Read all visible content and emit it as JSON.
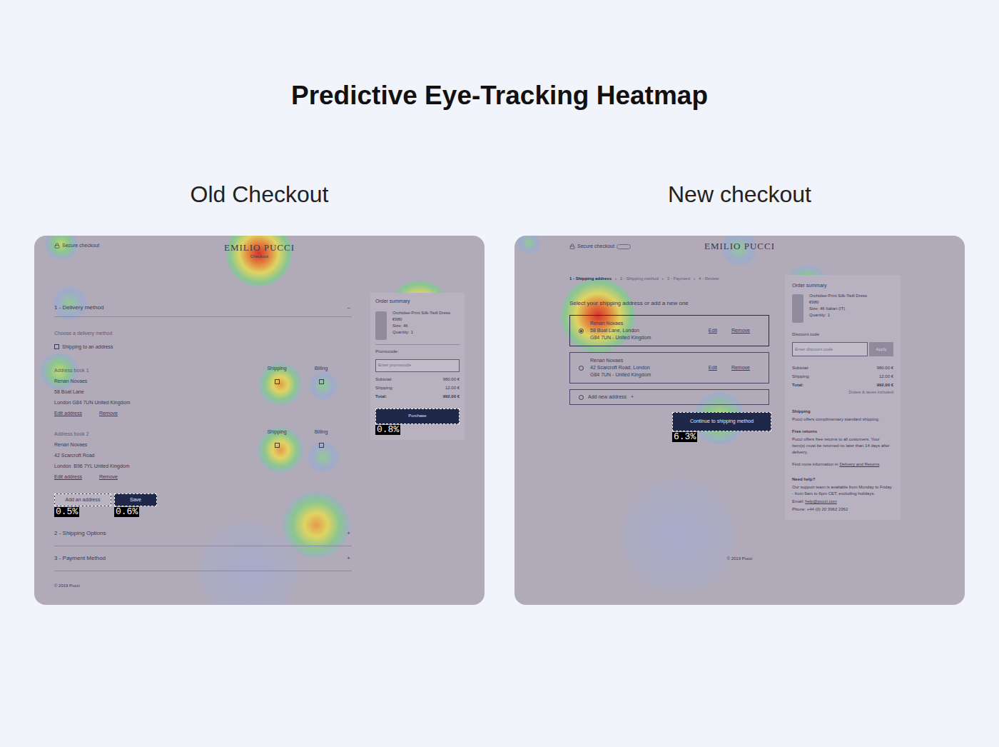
{
  "title": "Predictive Eye-Tracking Heatmap",
  "old_checkout": {
    "heading": "Old Checkout",
    "secure": "Secure checkout",
    "logo": "EMILIO PUCCI",
    "logo_sub": "Checkout",
    "sections": [
      {
        "label": "1 - Delivery method",
        "toggle": "–",
        "expanded": true
      },
      {
        "label": "2 - Shipping Options",
        "toggle": "+",
        "expanded": false
      },
      {
        "label": "3 - Payment Method",
        "toggle": "+",
        "expanded": false
      }
    ],
    "choose": "Choose a delivery method",
    "shipping_option": {
      "label": "Shipping to an address",
      "checked": false
    },
    "addresses": [
      {
        "title": "Address book 1",
        "lines": [
          "Renan Novaes",
          "58 Boat Lane",
          "London G84 7UN United Kingdom"
        ],
        "edit": "Edit address",
        "remove": "Remove",
        "shipping": {
          "label": "Shipping",
          "checked": false
        },
        "billing": {
          "label": "Billing",
          "checked": false
        }
      },
      {
        "title": "Address book 2",
        "lines": [
          "Renan Novaes",
          "42 Scarcroft Road",
          "London  B96 7YL United Kingdom"
        ],
        "edit": "Edit address",
        "remove": "Remove",
        "shipping": {
          "label": "Shipping",
          "checked": false
        },
        "billing": {
          "label": "Billing",
          "checked": false
        }
      }
    ],
    "buttons": [
      {
        "label": "Add an address",
        "kind": "outline",
        "click_rate": "0.5%"
      },
      {
        "label": "Save",
        "kind": "solid",
        "click_rate": "0.6%"
      }
    ],
    "footer": "© 2019 Pucci",
    "summary": {
      "title": "Order summary",
      "product": "Orchidee-Print Silk-Twill Dress",
      "price": "€980",
      "size": "Size: 46",
      "quantity": "Quantity: 1",
      "promo_label": "Promocode:",
      "promo_placeholder": "Enter promocode",
      "totals": [
        {
          "label": "Subtotal:",
          "value": "980.00 €",
          "bold": false
        },
        {
          "label": "Shipping:",
          "value": "12.00 €",
          "bold": false
        },
        {
          "label": "Total:",
          "value": "992.00 €",
          "bold": true
        }
      ],
      "button": "Purchase",
      "click_rate": "0.8%"
    },
    "heatmap": [
      {
        "level": 0.95
      },
      {
        "level": 0.45
      },
      {
        "level": 0.9
      },
      {
        "level": 0.7
      },
      {
        "level": 0.3
      },
      {
        "level": 0.7
      },
      {
        "level": 0.35
      },
      {
        "level": 0.45
      },
      {
        "level": 0.65
      },
      {
        "level": 0.3
      },
      {
        "level": 0.1
      }
    ]
  },
  "new_checkout": {
    "heading": "New checkout",
    "secure": "Secure checkout",
    "logo": "EMILIO PUCCI",
    "steps": [
      {
        "label": "1 - Shipping address",
        "selected": true
      },
      {
        "label": "2 - Shipping method",
        "selected": false
      },
      {
        "label": "3 - Payment",
        "selected": false
      },
      {
        "label": "4 - Review",
        "selected": false
      }
    ],
    "separator": "›",
    "prompt": "Select your shipping address or add a new one",
    "addresses": [
      {
        "name": "Renan Novaes",
        "lines": [
          "58 Boat Lane, London",
          "G84 7UN - United Kingdom"
        ],
        "selected": true
      },
      {
        "name": "Renan Novaes",
        "lines": [
          "42 Scarcroft Road, London",
          "G84 7UN - United Kingdom"
        ],
        "selected": false
      }
    ],
    "edit": "Edit",
    "remove": "Remove",
    "add": "Add new address",
    "add_icon": "+",
    "button": "Continue to shipping method",
    "click_rate": "6.3%",
    "footer": "© 2019 Pucci",
    "summary": {
      "title": "Order summary",
      "product": "Orchidee-Print Silk-Twill Dress",
      "price": "€980",
      "size": "Size: 46 Italian (IT)",
      "quantity": "Quantity: 1",
      "discount_label": "Discount code",
      "discount_placeholder": "Enter discount code",
      "apply": "Apply",
      "totals": [
        {
          "label": "Subtotal:",
          "value": "980.00 €",
          "bold": false
        },
        {
          "label": "Shipping:",
          "value": "12.00 €",
          "bold": false
        },
        {
          "label": "Total:",
          "value": "992.00 €",
          "bold": true
        }
      ],
      "duties": "Duties & taxes included",
      "info": [
        {
          "title": "Shipping",
          "text": "Pucci offers complimentary standard shipping."
        },
        {
          "title": "Free returns",
          "text": "Pucci offers free returns to all customers. Your item(s) must be returned no later than 14 days after delivery."
        }
      ],
      "more_text": "Find more information in",
      "more_link": "Delivery and Returns",
      "help_title": "Need help?",
      "help_text": "Our support team is available from Monday to Friday - from 9am to 6pm CET, excluding holidays.",
      "email_label": "Email:",
      "email": "help@pucci.com",
      "phone": "Phone: +44 (0) 20 3962 2362"
    },
    "heatmap": [
      {
        "level": 0.95
      },
      {
        "level": 0.3
      },
      {
        "level": 0.5
      },
      {
        "level": 0.4
      },
      {
        "level": 0.5
      },
      {
        "level": 0.25
      },
      {
        "level": 0.1
      }
    ]
  }
}
